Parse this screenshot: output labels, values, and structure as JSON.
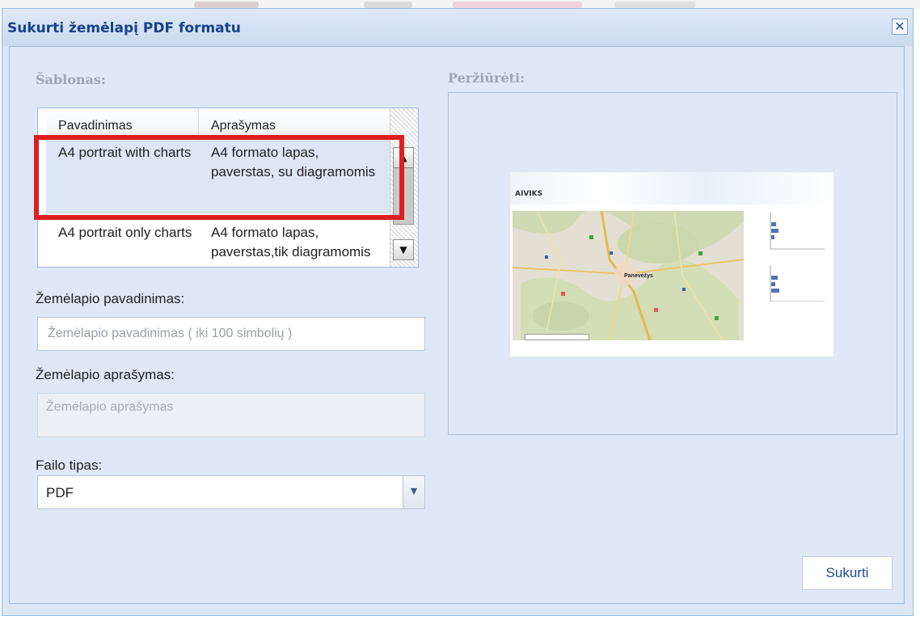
{
  "dialog": {
    "title": "Sukurti žemėlapį PDF formatu",
    "close_icon": "close-icon"
  },
  "template_section": {
    "label": "Šablonas:",
    "columns": [
      "Pavadinimas",
      "Aprašymas"
    ],
    "rows": [
      {
        "name": "A4 portrait with charts",
        "description": "A4 formato lapas, paverstas, su diagramomis",
        "selected": true
      },
      {
        "name": "A4 portrait only charts",
        "description": "A4 formato lapas, paverstas,tik diagramomis",
        "selected": false
      }
    ]
  },
  "map_name": {
    "label": "Žemėlapio pavadinimas:",
    "placeholder": "Žemėlapio pavadinimas ( iki 100 simbolių )",
    "value": ""
  },
  "map_description": {
    "label": "Žemėlapio aprašymas:",
    "placeholder": "Žemėlapio aprašymas",
    "value": ""
  },
  "file_type": {
    "label": "Failo tipas:",
    "value": "PDF"
  },
  "preview": {
    "label": "Peržiūrėti:",
    "thumbnail_brand": "AIVIKS",
    "thumbnail_city": "Panevėžys"
  },
  "actions": {
    "create_label": "Sukurti"
  },
  "colors": {
    "title": "#15428b",
    "highlight": "#dd1f1f",
    "panel": "#dfe8f6"
  }
}
